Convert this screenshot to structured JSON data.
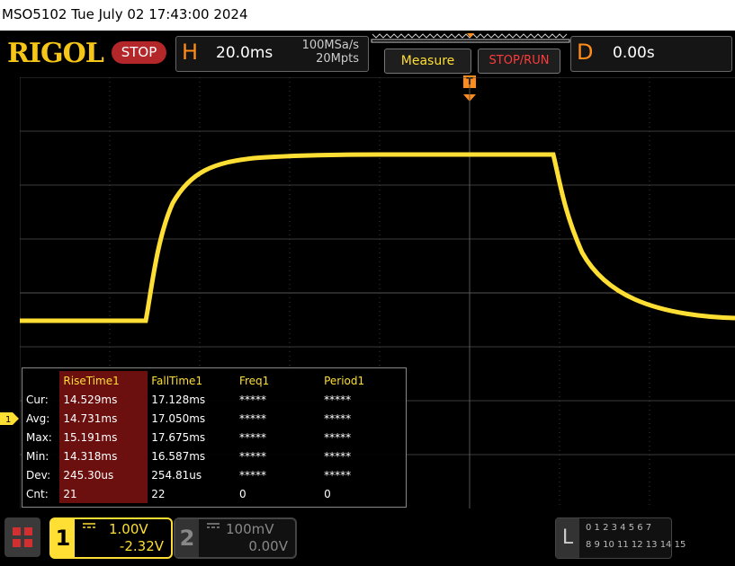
{
  "window": {
    "title": "MSO5102   Tue July 02 17:43:00 2024"
  },
  "header": {
    "brand": "RIGOL",
    "run_state": "STOP",
    "horizontal": {
      "letter": "H",
      "timebase": "20.0ms",
      "sample_rate": "100MSa/s",
      "memory_depth": "20Mpts"
    },
    "measure_button": "Measure",
    "stoprun_button": "STOP/RUN",
    "delay": {
      "letter": "D",
      "value": "0.00s"
    },
    "trigger_marker": "T"
  },
  "colors": {
    "ch1": "#ffdf33",
    "ch2": "#888888",
    "trigger": "#ff8c1a",
    "stop": "#b3262a",
    "selected_column": "#6b0f0f",
    "grid": "#3c3c3c"
  },
  "measurements": {
    "headers": [
      "RiseTime1",
      "FallTime1",
      "Freq1",
      "Period1"
    ],
    "rows": [
      {
        "label": "Cur:",
        "values": [
          "14.529ms",
          "17.128ms",
          "*****",
          "*****"
        ]
      },
      {
        "label": "Avg:",
        "values": [
          "14.731ms",
          "17.050ms",
          "*****",
          "*****"
        ]
      },
      {
        "label": "Max:",
        "values": [
          "15.191ms",
          "17.675ms",
          "*****",
          "*****"
        ]
      },
      {
        "label": "Min:",
        "values": [
          "14.318ms",
          "16.587ms",
          "*****",
          "*****"
        ]
      },
      {
        "label": "Dev:",
        "values": [
          "245.30us",
          "254.81us",
          "*****",
          "*****"
        ]
      },
      {
        "label": "Cnt:",
        "values": [
          "21",
          "22",
          "0",
          "0"
        ]
      }
    ]
  },
  "channels": [
    {
      "number": "1",
      "scale": "1.00V",
      "offset": "-2.32V",
      "coupling_icon": "dc-coupling-icon"
    },
    {
      "number": "2",
      "scale": "100mV",
      "offset": "0.00V",
      "coupling_icon": "dc-coupling-icon"
    }
  ],
  "ch1_marker": "1",
  "la": {
    "letter": "L",
    "row1": "0 1 2 3   4 5 6 7",
    "row2": "8 9 10 11  12 13 14 15"
  },
  "menu_icon": "grid-menu-icon"
}
